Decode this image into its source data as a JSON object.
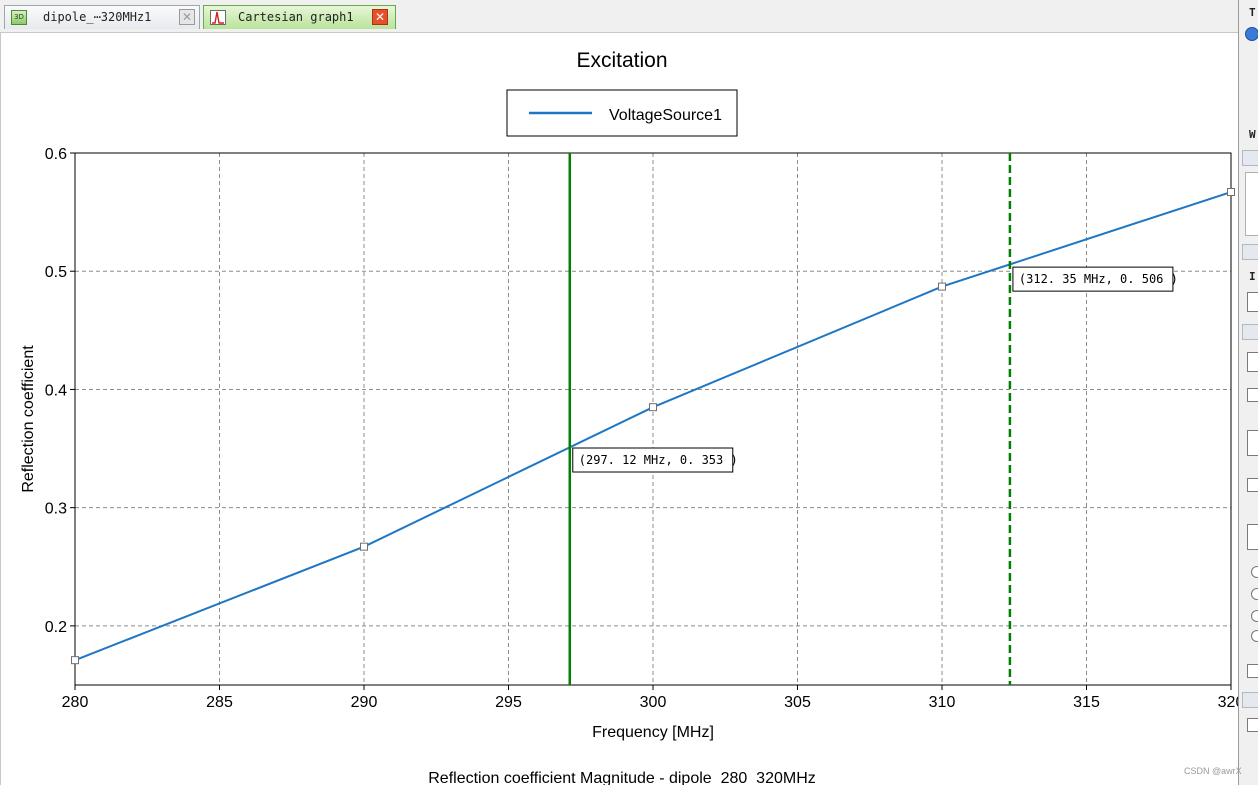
{
  "tabs": [
    {
      "label": "dipole_⋯320MHz1",
      "icon": "3d-view-icon",
      "active": false
    },
    {
      "label": "Cartesian graph1",
      "icon": "graph-icon",
      "active": true
    }
  ],
  "watermark": "CSDN @awrX",
  "chart_data": {
    "type": "line",
    "title": "Excitation",
    "xlabel": "Frequency [MHz]",
    "ylabel": "Reflection coefficient",
    "caption": "Reflection coefficient Magnitude - dipole_280_320MHz",
    "xlim": [
      280,
      320
    ],
    "ylim": [
      0.15,
      0.6
    ],
    "xticks": [
      280,
      285,
      290,
      295,
      300,
      305,
      310,
      315,
      320
    ],
    "yticks": [
      0.2,
      0.3,
      0.4,
      0.5,
      0.6
    ],
    "ytick_labels": [
      "0.2",
      "0.3",
      "0.4",
      "0.5",
      "0.6"
    ],
    "grid": true,
    "legend_position": "top-center",
    "series": [
      {
        "name": "VoltageSource1",
        "color": "#1f77c4",
        "x": [
          280,
          290,
          300,
          310,
          320
        ],
        "y": [
          0.171,
          0.267,
          0.385,
          0.487,
          0.567
        ]
      }
    ],
    "markers": [
      {
        "x": 297.12,
        "style": "solid",
        "color": "#008000",
        "label": "(297. 12 MHz,  0. 353 )",
        "y": 0.353
      },
      {
        "x": 312.35,
        "style": "dashed",
        "color": "#008000",
        "label": "(312. 35 MHz,  0. 506 )",
        "y": 0.506
      }
    ]
  }
}
